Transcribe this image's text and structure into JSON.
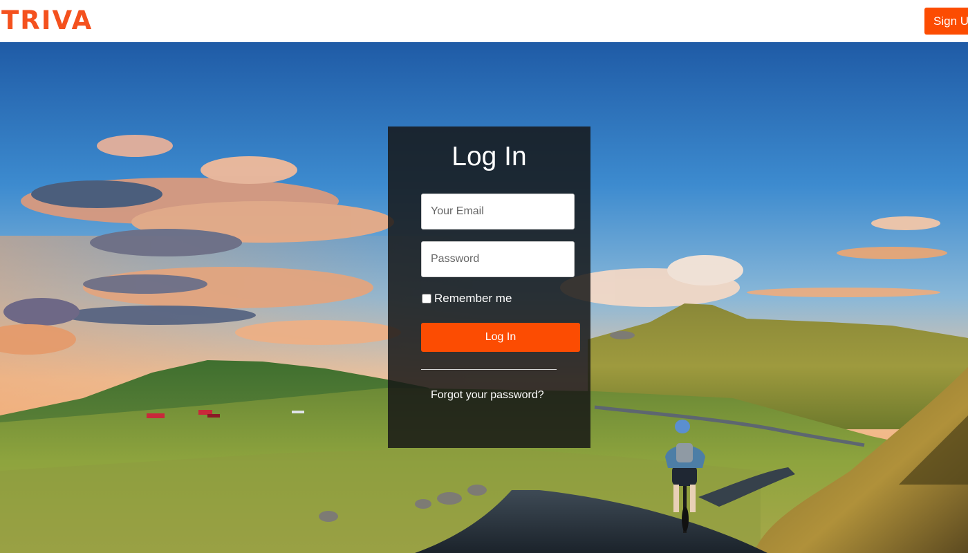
{
  "header": {
    "logo_text": "TRIVA",
    "signup_label": "Sign Up"
  },
  "colors": {
    "brand": "#fc4c02",
    "panel_background": "#161616"
  },
  "login": {
    "title": "Log In",
    "email_placeholder": "Your Email",
    "password_placeholder": "Password",
    "remember_label": "Remember me",
    "remember_checked": false,
    "submit_label": "Log In",
    "forgot_label": "Forgot your password?"
  }
}
